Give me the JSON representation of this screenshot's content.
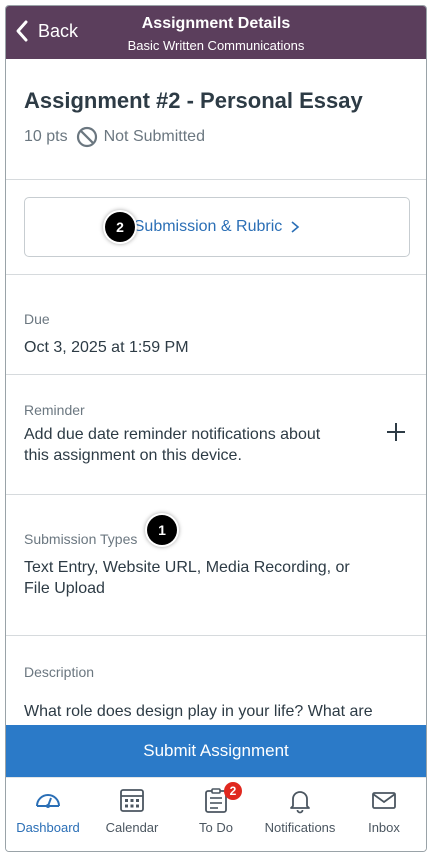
{
  "header": {
    "back_label": "Back",
    "title": "Assignment Details",
    "subtitle": "Basic Written Communications",
    "background": "#5b3e5c"
  },
  "assignment": {
    "title": "Assignment #2 - Personal Essay",
    "points": "10 pts",
    "status": "Not Submitted"
  },
  "submission_button": {
    "label": "Submission & Rubric",
    "callout": "2"
  },
  "due": {
    "label": "Due",
    "value": "Oct 3, 2025 at 1:59 PM"
  },
  "reminder": {
    "label": "Reminder",
    "line1": "Add due date reminder notifications about",
    "line2": "this assignment on this device."
  },
  "submission_types": {
    "label": "Submission Types",
    "callout": "1",
    "line1": "Text Entry, Website URL, Media Recording, or",
    "line2": "File Upload"
  },
  "description": {
    "label": "Description",
    "text": "What role does design play in your life? What are"
  },
  "submit": {
    "label": "Submit Assignment",
    "color": "#2b7ac8"
  },
  "tabs": [
    {
      "label": "Dashboard",
      "icon": "dashboard-icon",
      "active": true
    },
    {
      "label": "Calendar",
      "icon": "calendar-icon"
    },
    {
      "label": "To Do",
      "icon": "todo-icon",
      "badge": "2"
    },
    {
      "label": "Notifications",
      "icon": "bell-icon"
    },
    {
      "label": "Inbox",
      "icon": "mail-icon"
    }
  ],
  "colors": {
    "accent": "#2b6fb6",
    "badge": "#e0281f"
  }
}
